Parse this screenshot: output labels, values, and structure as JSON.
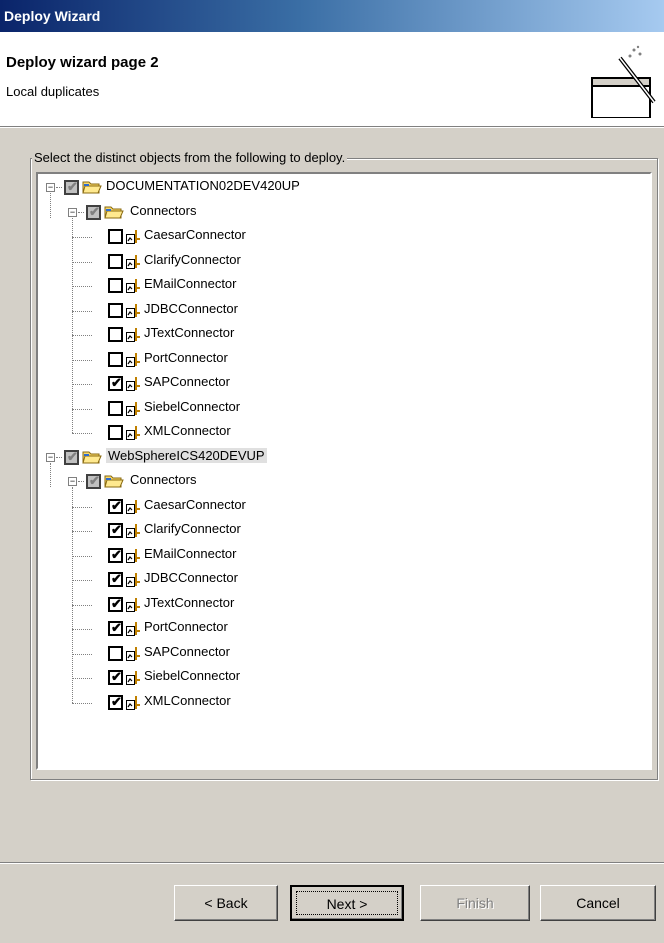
{
  "window": {
    "title": "Deploy Wizard"
  },
  "header": {
    "page_title": "Deploy wizard page 2",
    "description": "Local duplicates",
    "icon": "wizard-wand-icon"
  },
  "group": {
    "label": "Select the distinct objects from the following to deploy."
  },
  "tree": [
    {
      "label": "DOCUMENTATION02DEV420UP",
      "checked": "grayed",
      "selected": false,
      "children": [
        {
          "label": "Connectors",
          "checked": "grayed",
          "children": [
            {
              "label": "CaesarConnector",
              "checked": false
            },
            {
              "label": "ClarifyConnector",
              "checked": false
            },
            {
              "label": "EMailConnector",
              "checked": false
            },
            {
              "label": "JDBCConnector",
              "checked": false
            },
            {
              "label": "JTextConnector",
              "checked": false
            },
            {
              "label": "PortConnector",
              "checked": false
            },
            {
              "label": "SAPConnector",
              "checked": true
            },
            {
              "label": "SiebelConnector",
              "checked": false
            },
            {
              "label": "XMLConnector",
              "checked": false
            }
          ]
        }
      ]
    },
    {
      "label": "WebSphereICS420DEVUP",
      "checked": "grayed",
      "selected": true,
      "children": [
        {
          "label": "Connectors",
          "checked": "grayed",
          "children": [
            {
              "label": "CaesarConnector",
              "checked": true
            },
            {
              "label": "ClarifyConnector",
              "checked": true
            },
            {
              "label": "EMailConnector",
              "checked": true
            },
            {
              "label": "JDBCConnector",
              "checked": true
            },
            {
              "label": "JTextConnector",
              "checked": true
            },
            {
              "label": "PortConnector",
              "checked": true
            },
            {
              "label": "SAPConnector",
              "checked": false
            },
            {
              "label": "SiebelConnector",
              "checked": true
            },
            {
              "label": "XMLConnector",
              "checked": true
            }
          ]
        }
      ]
    }
  ],
  "buttons": {
    "back": "< Back",
    "next": "Next >",
    "finish": "Finish",
    "cancel": "Cancel"
  }
}
